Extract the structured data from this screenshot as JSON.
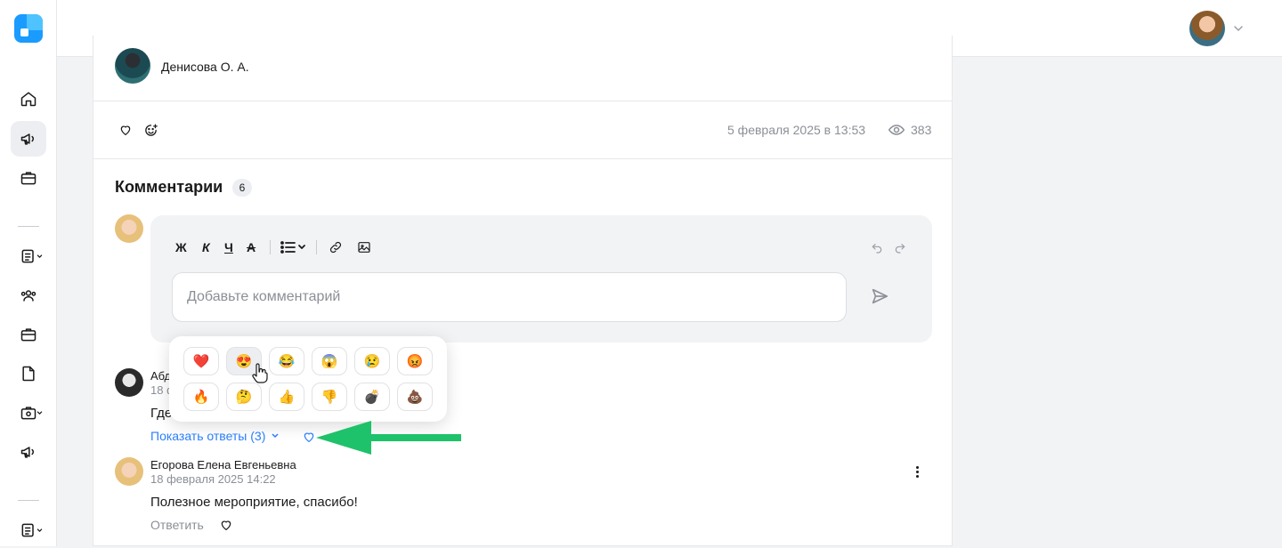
{
  "sidebar": {
    "logo": "app-logo",
    "items": [
      {
        "icon": "home-icon"
      },
      {
        "icon": "megaphone-icon",
        "active": true
      },
      {
        "icon": "briefcase-icon"
      },
      {
        "icon": "document-list-icon"
      },
      {
        "icon": "users-icon"
      },
      {
        "icon": "briefcase-icon"
      },
      {
        "icon": "file-icon"
      },
      {
        "icon": "settings-briefcase-icon"
      },
      {
        "icon": "megaphone-icon"
      },
      {
        "icon": "document-list-icon"
      }
    ]
  },
  "header": {
    "user_avatar": "user-avatar",
    "menu_icon": "chevron-down-icon"
  },
  "post": {
    "author": "Денисова О. А.",
    "date": "5 февраля 2025 в 13:53",
    "views": "383"
  },
  "comments": {
    "title": "Комментарии",
    "count": "6",
    "toolbar": {
      "bold": "Ж",
      "italic": "К",
      "underline": "Ч",
      "strike": "А"
    },
    "input_placeholder": "Добавьте комментарий",
    "items": [
      {
        "author": "Абд",
        "date": "18 ф",
        "text": "Где",
        "show_replies": "Показать ответы (3)"
      },
      {
        "author": "Егорова Елена Евгеньевна",
        "date": "18 февраля 2025 14:22",
        "text": "Полезное мероприятие, спасибо!",
        "reply": "Ответить"
      }
    ]
  },
  "reactions": [
    "❤️",
    "😍",
    "😂",
    "😱",
    "😢",
    "😡",
    "🔥",
    "🤔",
    "👍",
    "👎",
    "💣",
    "💩"
  ],
  "colors": {
    "accent": "#2a7fff",
    "arrow": "#1ec26a"
  }
}
